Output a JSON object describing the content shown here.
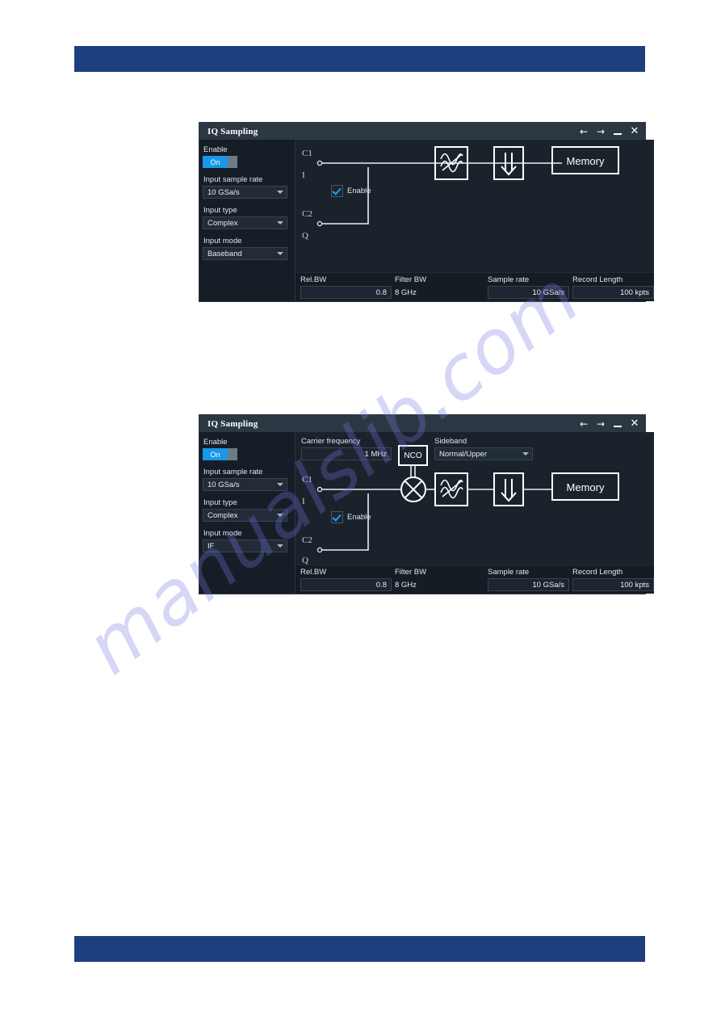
{
  "page": {
    "header_bar": "",
    "footer_bar": "",
    "watermark": "manualslib.com"
  },
  "dialogs": [
    {
      "id": "baseband",
      "title": "IQ Sampling",
      "window_buttons": {
        "back": "←",
        "forward": "→",
        "minimize": "",
        "close": "✕"
      },
      "sidebar": {
        "enable_label": "Enable",
        "enable_state": "On",
        "input_sample_rate_label": "Input sample rate",
        "input_sample_rate_value": "10 GSa/s",
        "input_type_label": "Input type",
        "input_type_value": "Complex",
        "input_mode_label": "Input mode",
        "input_mode_value": "Baseband"
      },
      "diagram": {
        "has_nco": false,
        "channel1_label": "C1",
        "channel1_sub": "I",
        "channel2_label": "C2",
        "channel2_sub": "Q",
        "enable_checkbox_label": "Enable",
        "enable_checkbox_checked": true,
        "filter_icon": "lowpass-filter-icon",
        "decimator_icon": "downsample-arrow-icon",
        "memory_label": "Memory"
      },
      "status": {
        "rel_bw_label": "Rel.BW",
        "rel_bw_value": "0.8",
        "filter_bw_label": "Filter BW",
        "filter_bw_value": "8 GHz",
        "sample_rate_label": "Sample rate",
        "sample_rate_value": "10 GSa/s",
        "record_length_label": "Record Length",
        "record_length_value": "100 kpts"
      }
    },
    {
      "id": "if",
      "title": "IQ Sampling",
      "window_buttons": {
        "back": "←",
        "forward": "→",
        "minimize": "",
        "close": "✕"
      },
      "sidebar": {
        "enable_label": "Enable",
        "enable_state": "On",
        "input_sample_rate_label": "Input sample rate",
        "input_sample_rate_value": "10 GSa/s",
        "input_type_label": "Input type",
        "input_type_value": "Complex",
        "input_mode_label": "Input mode",
        "input_mode_value": "IF"
      },
      "toprow": {
        "carrier_frequency_label": "Carrier frequency",
        "carrier_frequency_value": "1 MHz",
        "nco_label": "NCO",
        "sideband_label": "Sideband",
        "sideband_value": "Normal/Upper"
      },
      "diagram": {
        "has_nco": true,
        "channel1_label": "C1",
        "channel1_sub": "I",
        "channel2_label": "C2",
        "channel2_sub": "Q",
        "enable_checkbox_label": "Enable",
        "enable_checkbox_checked": true,
        "mixer_icon": "mixer-circle-x-icon",
        "filter_icon": "lowpass-filter-icon",
        "decimator_icon": "downsample-arrow-icon",
        "memory_label": "Memory"
      },
      "status": {
        "rel_bw_label": "Rel.BW",
        "rel_bw_value": "0.8",
        "filter_bw_label": "Filter BW",
        "filter_bw_value": "8 GHz",
        "sample_rate_label": "Sample rate",
        "sample_rate_value": "10 GSa/s",
        "record_length_label": "Record Length",
        "record_length_value": "100 kpts"
      }
    }
  ],
  "colors": {
    "page_bar": "#1e3f7f",
    "accent_blue": "#1898e8",
    "dialog_bg": "#151c24",
    "panel_bg": "#1a222c",
    "titlebar_bg": "#2b3843"
  }
}
